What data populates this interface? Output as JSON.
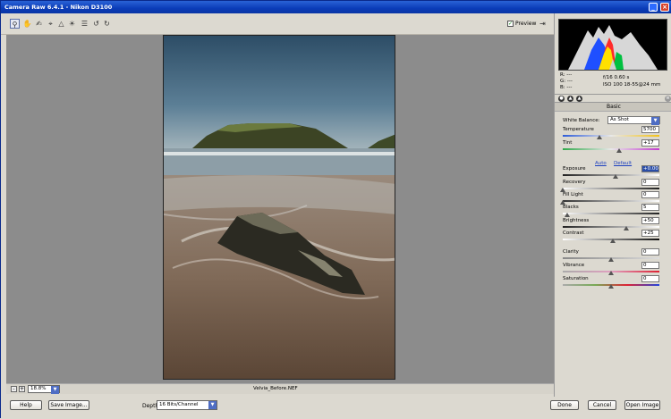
{
  "window": {
    "title": "Camera Raw 6.4.1  -  Nikon D3100"
  },
  "toolbar": {
    "tools": [
      "zoom-icon",
      "hand-icon",
      "white-balance-icon",
      "crop-icon",
      "straighten-icon",
      "spot-removal-icon",
      "preferences-icon",
      "rotate-left-icon",
      "rotate-right-icon"
    ],
    "preview_label": "Preview",
    "preview_checked": true
  },
  "status": {
    "zoom": "18.8%",
    "filename": "Velvia_Before.NEF"
  },
  "bottom": {
    "help": "Help",
    "save_image": "Save Image...",
    "depth_label": "Depth:",
    "depth_value": "16 Bits/Channel",
    "done": "Done",
    "cancel": "Cancel",
    "open_image": "Open Image"
  },
  "histogram_info": {
    "r": "R:  ---",
    "g": "G:  ---",
    "b": "B:  ---",
    "line1": "f/16  0.60 s",
    "line2": "ISO 100   18-55@24 mm"
  },
  "panel": {
    "title": "Basic",
    "white_balance_label": "White Balance:",
    "white_balance_value": "As Shot",
    "auto": "Auto",
    "default": "Default",
    "sliders": [
      {
        "label": "Temperature",
        "value": "5700",
        "pos": 0.38
      },
      {
        "label": "Tint",
        "value": "+17",
        "pos": 0.58
      },
      {
        "label": "Exposure",
        "value": "+0.00",
        "pos": 0.55
      },
      {
        "label": "Recovery",
        "value": "0",
        "pos": 0.0
      },
      {
        "label": "Fill Light",
        "value": "0",
        "pos": 0.0
      },
      {
        "label": "Blacks",
        "value": "5",
        "pos": 0.05
      },
      {
        "label": "Brightness",
        "value": "+50",
        "pos": 0.66
      },
      {
        "label": "Contrast",
        "value": "+25",
        "pos": 0.52
      },
      {
        "label": "Clarity",
        "value": "0",
        "pos": 0.5
      },
      {
        "label": "Vibrance",
        "value": "0",
        "pos": 0.5
      },
      {
        "label": "Saturation",
        "value": "0",
        "pos": 0.5
      }
    ]
  }
}
